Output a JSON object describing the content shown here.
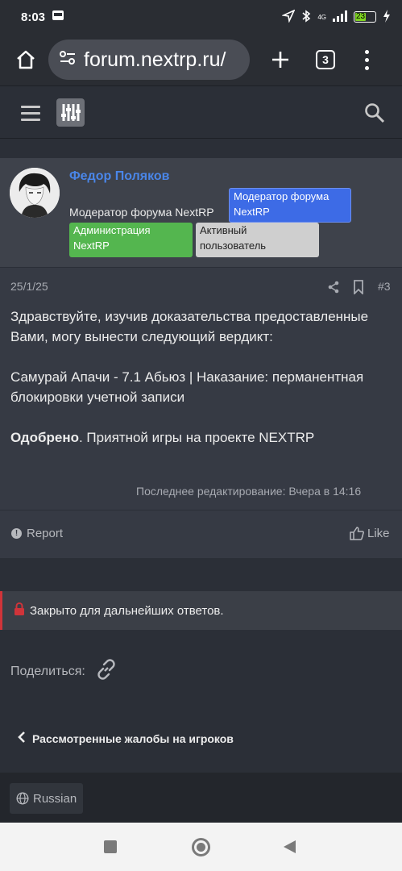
{
  "status_bar": {
    "time": "8:03",
    "battery": "23",
    "network": "4G"
  },
  "browser": {
    "url": "forum.nextrp.ru/",
    "tab_count": "3"
  },
  "post": {
    "author": "Федор Поляков",
    "user_title": "Модератор форума NextRP",
    "badges": {
      "moderator": "Модератор форума NextRP",
      "admin": "Администрация NextRP",
      "active": "Активный пользователь"
    },
    "date": "25/1/25",
    "number": "#3",
    "body_paragraph_1": "Здравствуйте, изучив доказательства предоставленные Вами, могу вынести следующий вердикт:",
    "body_paragraph_2": "Самурай Апачи - 7.1 Абьюз | Наказание: перманентная блокировки учетной записи",
    "verdict_bold": "Одобрено",
    "verdict_rest": ". Приятной игры на проекте NEXTRP",
    "edit_note": "Последнее редактирование: Вчера в 14:16",
    "report_label": "Report",
    "like_label": "Like"
  },
  "thread": {
    "closed_notice": "Закрыто для дальнейших ответов.",
    "share_label": "Поделиться:",
    "breadcrumb": "Рассмотренные жалобы на игроков"
  },
  "footer": {
    "language": "Russian"
  },
  "colors": {
    "accent_link": "#4a86e8",
    "badge_blue": "#3d6be6",
    "badge_green": "#54b64f",
    "badge_gray": "#cfcfcf",
    "closed_stripe": "#d0343a",
    "page_bg": "#2b2f37"
  }
}
